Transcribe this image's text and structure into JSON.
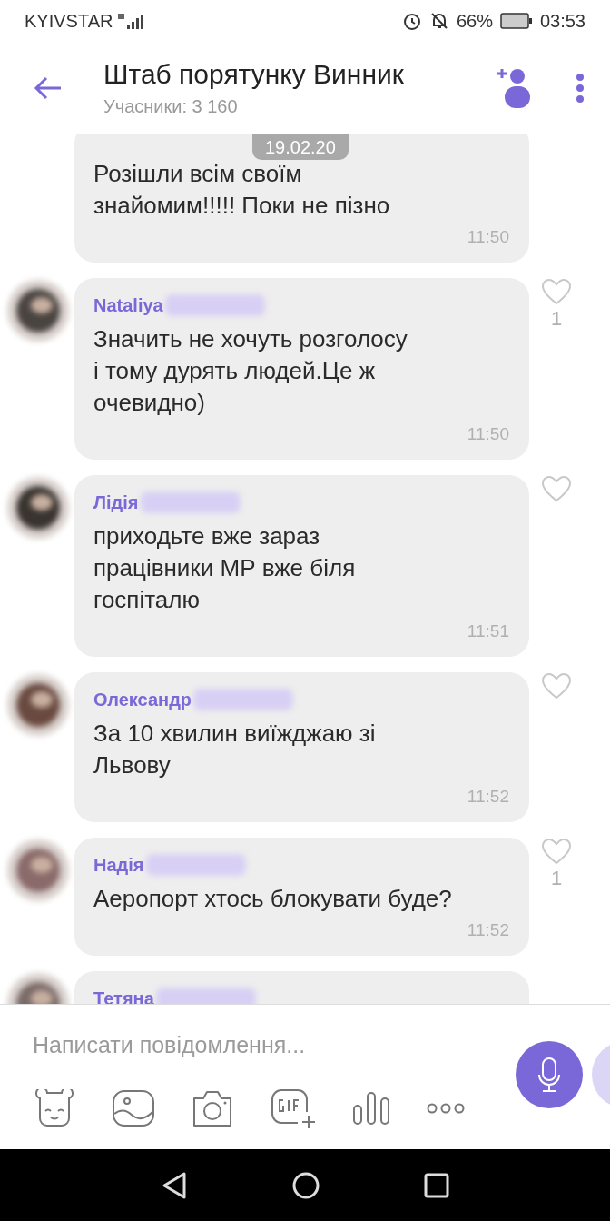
{
  "status_bar": {
    "carrier": "KYIVSTAR",
    "battery": "66%",
    "time": "03:53"
  },
  "header": {
    "title": "Штаб порятунку Винник",
    "subtitle": "Учасники: 3 160"
  },
  "date_badge": "19.02.20",
  "messages": [
    {
      "text": "Розішли всім своїм\nзнайомим!!!!! Поки не пізно",
      "time": "11:50",
      "heart": false
    },
    {
      "sender": "Nataliya",
      "text": "Значить не хочуть розголосу\nі тому дурять людей.Це  ж\nочевидно)",
      "time": "11:50",
      "heart": true,
      "likes": "1"
    },
    {
      "sender": "Лідія",
      "text": "приходьте вже зараз\nпрацівники МР вже біля\nгоспіталю",
      "time": "11:51",
      "heart": true
    },
    {
      "sender": "Олександр",
      "text": "За 10 хвилин виїжджаю зі\nЛьвову",
      "time": "11:52",
      "heart": true
    },
    {
      "sender": "Надія",
      "text": "Аеропорт хтось блокувати буде?",
      "time": "11:52",
      "heart": true,
      "likes": "1"
    },
    {
      "sender": "Тетяна",
      "heart": false
    }
  ],
  "composer": {
    "placeholder": "Написати повідомлення..."
  }
}
